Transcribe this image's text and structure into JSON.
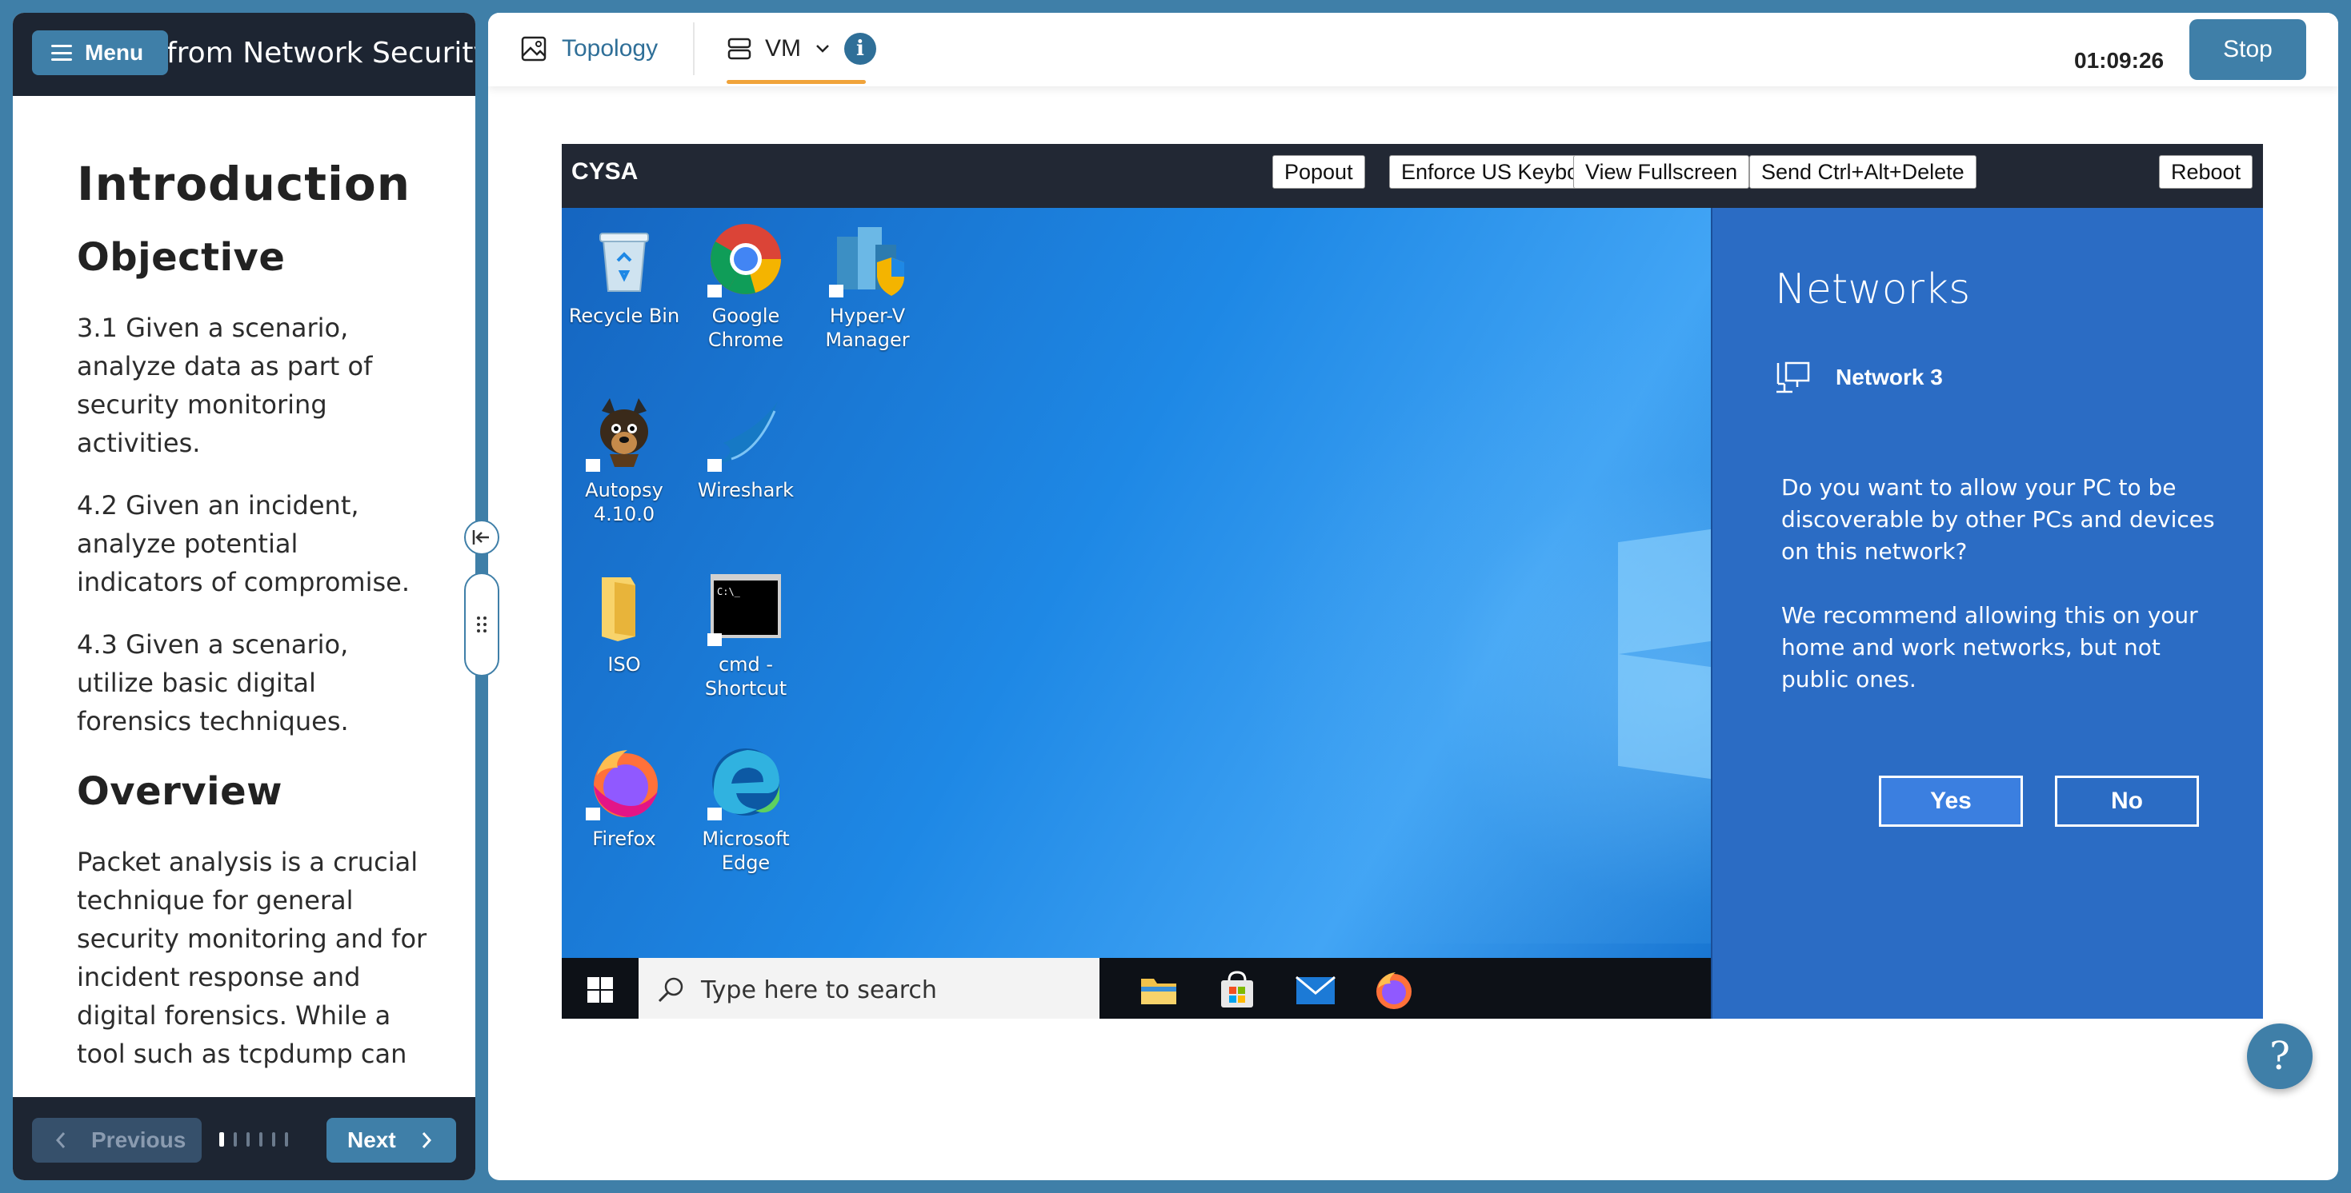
{
  "lab": {
    "title": "from Network Security",
    "menu_label": "Menu"
  },
  "content": {
    "heading": "Introduction",
    "objective_heading": "Objective",
    "objectives": [
      "3.1 Given a scenario, analyze data as part of security monitoring activities.",
      "4.2 Given an incident, analyze potential indicators of compromise.",
      "4.3 Given a scenario, utilize basic digital forensics techniques."
    ],
    "overview_heading": "Overview",
    "overview_text": "Packet analysis is a crucial technique for general security monitoring and for incident response and digital forensics. While a tool such as tcpdump can"
  },
  "nav": {
    "previous_label": "Previous",
    "next_label": "Next"
  },
  "toolbar": {
    "topology_label": "Topology",
    "vm_label": "VM",
    "info_label": "i",
    "timer": "01:09:26",
    "stop_label": "Stop"
  },
  "vm": {
    "name": "CYSA",
    "buttons": {
      "popout": "Popout",
      "keyboard": "Enforce US Keyboard Layout",
      "fullscreen": "View Fullscreen",
      "ctrl_alt_del": "Send Ctrl+Alt+Delete",
      "reboot": "Reboot"
    },
    "desktop_icons": {
      "recycle_bin": "Recycle Bin",
      "chrome": "Google Chrome",
      "hyperv": "Hyper-V Manager",
      "autopsy": "Autopsy 4.10.0",
      "wireshark": "Wireshark",
      "iso": "ISO",
      "cmd": "cmd - Shortcut",
      "firefox": "Firefox",
      "edge": "Microsoft Edge"
    },
    "taskbar": {
      "search_placeholder": "Type here to search"
    },
    "networks_panel": {
      "title": "Networks",
      "network_name": "Network 3",
      "question": "Do you want to allow your PC to be discoverable by other PCs and devices on this network?",
      "recommendation": "We recommend allowing this on your home and work networks, but not public ones.",
      "yes_label": "Yes",
      "no_label": "No"
    }
  },
  "help_label": "?",
  "colors": {
    "accent": "#3f7fa8",
    "header_dark": "#1d2532",
    "tab_underline": "#f0a33a",
    "network_panel": "#2b6cc4"
  }
}
